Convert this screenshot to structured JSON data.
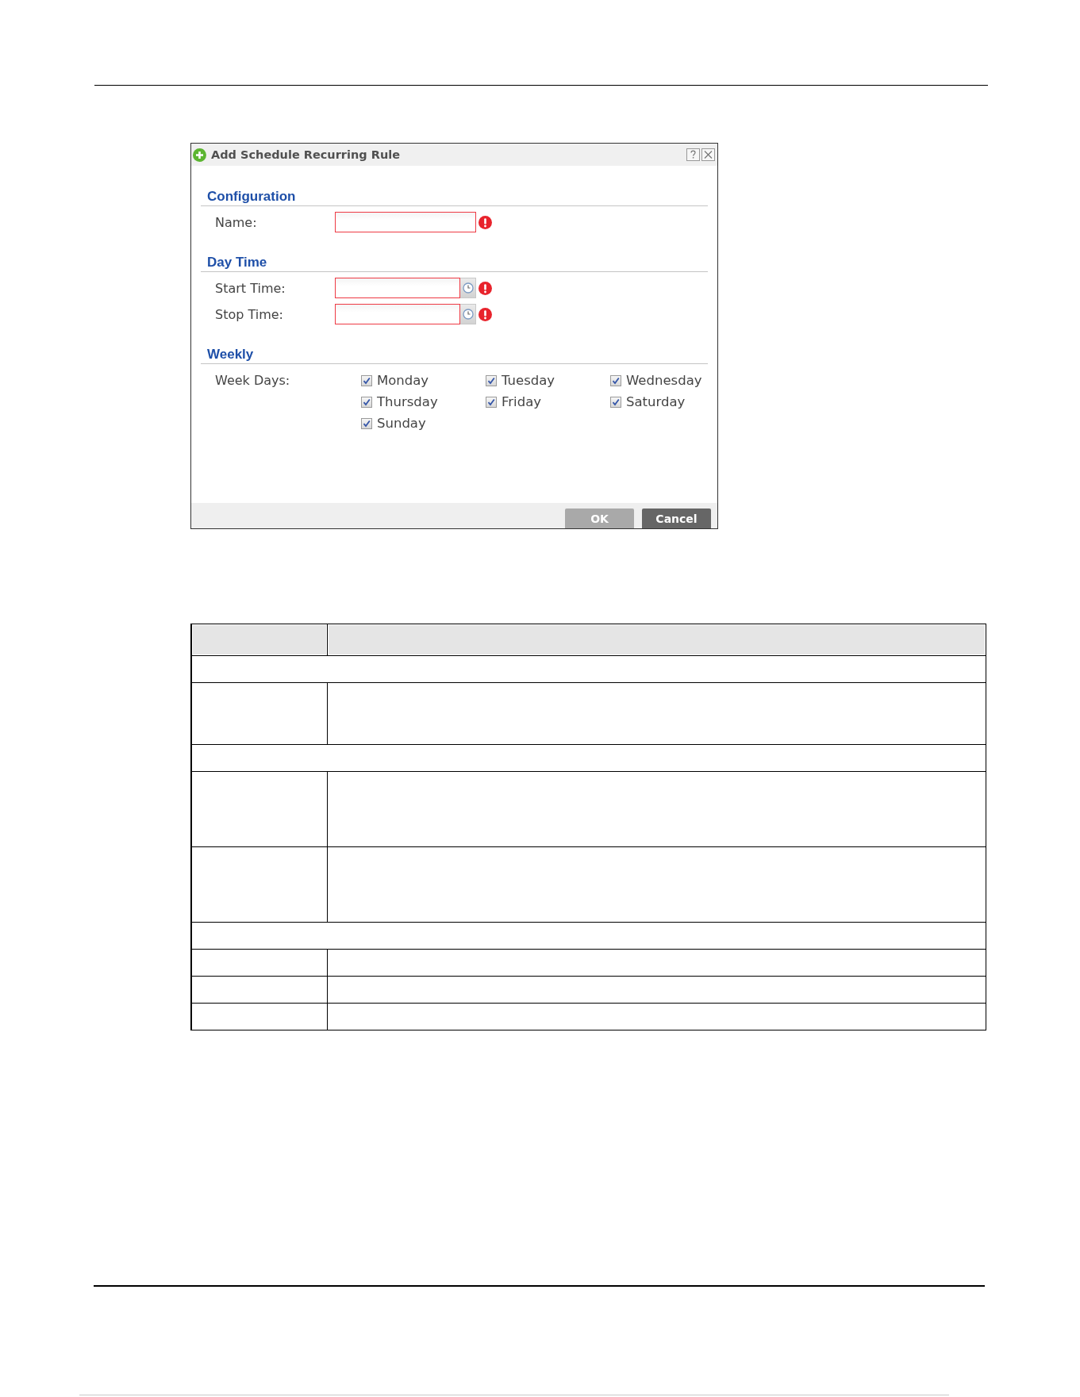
{
  "dialog": {
    "title": "Add Schedule Recurring Rule",
    "sections": [
      {
        "heading": "Configuration",
        "fields": [
          {
            "kind": "text",
            "label": "Name:",
            "invalid": true
          }
        ]
      },
      {
        "heading": "Day Time",
        "fields": [
          {
            "kind": "time",
            "label": "Start Time:",
            "invalid": true
          },
          {
            "kind": "time",
            "label": "Stop Time:",
            "invalid": true
          }
        ]
      },
      {
        "heading": "Weekly",
        "fields": [
          {
            "kind": "days",
            "label": "Week Days:",
            "options": [
              {
                "label": "Monday",
                "checked": true
              },
              {
                "label": "Tuesday",
                "checked": true
              },
              {
                "label": "Wednesday",
                "checked": true
              },
              {
                "label": "Thursday",
                "checked": true
              },
              {
                "label": "Friday",
                "checked": true
              },
              {
                "label": "Saturday",
                "checked": true
              },
              {
                "label": "Sunday",
                "checked": true
              }
            ]
          }
        ]
      }
    ],
    "buttons": [
      {
        "label": "OK",
        "disabled": true
      },
      {
        "label": "Cancel",
        "disabled": false
      }
    ]
  },
  "table": {
    "rows": [
      {
        "kind": "header"
      },
      {
        "kind": "section"
      },
      {
        "kind": "double"
      },
      {
        "kind": "section"
      },
      {
        "kind": "triple"
      },
      {
        "kind": "triple"
      },
      {
        "kind": "section"
      },
      {
        "kind": "single"
      },
      {
        "kind": "single"
      },
      {
        "kind": "single"
      }
    ]
  }
}
